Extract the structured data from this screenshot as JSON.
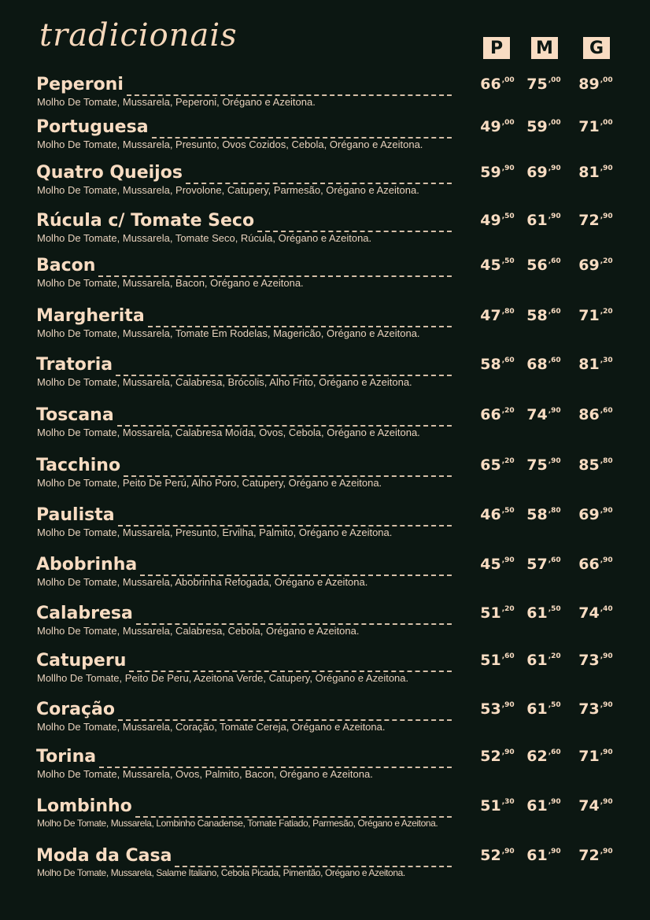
{
  "title": "tradicionais",
  "sizes": [
    "P",
    "M",
    "G"
  ],
  "items": [
    {
      "name": "Peperoni",
      "desc": "Molho De Tomate, Mussarela, Peperoni, Orégano e Azeitona.",
      "prices": [
        [
          "66",
          ",00"
        ],
        [
          "75",
          ",00"
        ],
        [
          "89",
          ",00"
        ]
      ]
    },
    {
      "name": "Portuguesa",
      "desc": "Molho De Tomate, Mussarela, Presunto, Ovos Cozidos, Cebola, Orégano e Azeitona.",
      "prices": [
        [
          "49",
          ",00"
        ],
        [
          "59",
          ",00"
        ],
        [
          "71",
          ",00"
        ]
      ]
    },
    {
      "name": "Quatro Queijos",
      "desc": "Molho De Tomate, Mussarela, Provolone, Catupery, Parmesão, Orégano e Azeitona.",
      "prices": [
        [
          "59",
          ",90"
        ],
        [
          "69",
          ",90"
        ],
        [
          "81",
          ",90"
        ]
      ]
    },
    {
      "name": "Rúcula c/ Tomate Seco",
      "desc": "Molho De Tomate, Mussarela, Tomate Seco, Rúcula, Orégano e Azeitona.",
      "prices": [
        [
          "49",
          ",50"
        ],
        [
          "61",
          ",90"
        ],
        [
          "72",
          ",90"
        ]
      ]
    },
    {
      "name": "Bacon",
      "desc": "Molho De Tomate, Mussarela, Bacon, Orégano e Azeitona.",
      "prices": [
        [
          "45",
          ",50"
        ],
        [
          "56",
          ",60"
        ],
        [
          "69",
          ",20"
        ]
      ]
    },
    {
      "name": "Margherita",
      "desc": "Molho De Tomate, Mussarela, Tomate Em Rodelas, Magericão, Orégano e Azeitona.",
      "prices": [
        [
          "47",
          ",80"
        ],
        [
          "58",
          ",60"
        ],
        [
          "71",
          ",20"
        ]
      ]
    },
    {
      "name": "Tratoria",
      "desc": "Molho De Tomate, Mussarela, Calabresa, Brócolis, Alho Frito, Orégano e Azeitona.",
      "prices": [
        [
          "58",
          ",60"
        ],
        [
          "68",
          ",60"
        ],
        [
          "81",
          ",30"
        ]
      ]
    },
    {
      "name": "Toscana",
      "desc": "Molho De Tomate, Mossarela, Calabresa Moída, Ovos, Cebola, Orégano e Azeitona.",
      "prices": [
        [
          "66",
          ",20"
        ],
        [
          "74",
          ",90"
        ],
        [
          "86",
          ",60"
        ]
      ]
    },
    {
      "name": "Tacchino",
      "desc": "Molho De Tomate, Peito De Perú, Alho Poro, Catupery, Orégano e Azeitona.",
      "prices": [
        [
          "65",
          ",20"
        ],
        [
          "75",
          ",90"
        ],
        [
          "85",
          ",80"
        ]
      ]
    },
    {
      "name": "Paulista",
      "desc": "Molho De Tomate, Mussarela, Presunto, Ervilha, Palmito, Orégano e Azeitona.",
      "prices": [
        [
          "46",
          ",50"
        ],
        [
          "58",
          ",80"
        ],
        [
          "69",
          ",90"
        ]
      ]
    },
    {
      "name": "Abobrinha",
      "desc": "Molho De Tomate, Mussarela, Abobrinha Refogada, Orégano e Azeitona.",
      "prices": [
        [
          "45",
          ",90"
        ],
        [
          "57",
          ",60"
        ],
        [
          "66",
          ",90"
        ]
      ]
    },
    {
      "name": "Calabresa",
      "desc": "Molho De Tomate, Mussarela, Calabresa, Cebola, Orégano e Azeitona.",
      "prices": [
        [
          "51",
          ",20"
        ],
        [
          "61",
          ",50"
        ],
        [
          "74",
          ",40"
        ]
      ]
    },
    {
      "name": "Catuperu",
      "desc": "Mollho De Tomate, Peito De Peru, Azeitona Verde, Catupery, Orégano e Azeitona.",
      "prices": [
        [
          "51",
          ",60"
        ],
        [
          "61",
          ",20"
        ],
        [
          "73",
          ",90"
        ]
      ]
    },
    {
      "name": "Coração",
      "desc": "Molho De Tomate, Mussarela, Coração, Tomate Cereja, Orégano e Azeitona.",
      "prices": [
        [
          "53",
          ",90"
        ],
        [
          "61",
          ",50"
        ],
        [
          "73",
          ",90"
        ]
      ]
    },
    {
      "name": "Torina",
      "desc": "Molho De Tomate, Mussarela, Ovos, Palmito, Bacon, Orégano e Azeitona.",
      "prices": [
        [
          "52",
          ",90"
        ],
        [
          "62",
          ",60"
        ],
        [
          "71",
          ",90"
        ]
      ]
    },
    {
      "name": "Lombinho",
      "desc": "Molho De Tomate, Mussarela, Lombinho Canadense, Tomate Fatiado, Parmesão, Orégano e Azeitona.",
      "prices": [
        [
          "51",
          ",30"
        ],
        [
          "61",
          ",90"
        ],
        [
          "74",
          ",90"
        ]
      ]
    },
    {
      "name": "Moda da Casa",
      "desc": "Molho De Tomate, Mussarela, Salame Italiano, Cebola Picada, Pimentão, Orégano e Azeitona.",
      "prices": [
        [
          "52",
          ",90"
        ],
        [
          "61",
          ",90"
        ],
        [
          "72",
          ",90"
        ]
      ]
    }
  ]
}
